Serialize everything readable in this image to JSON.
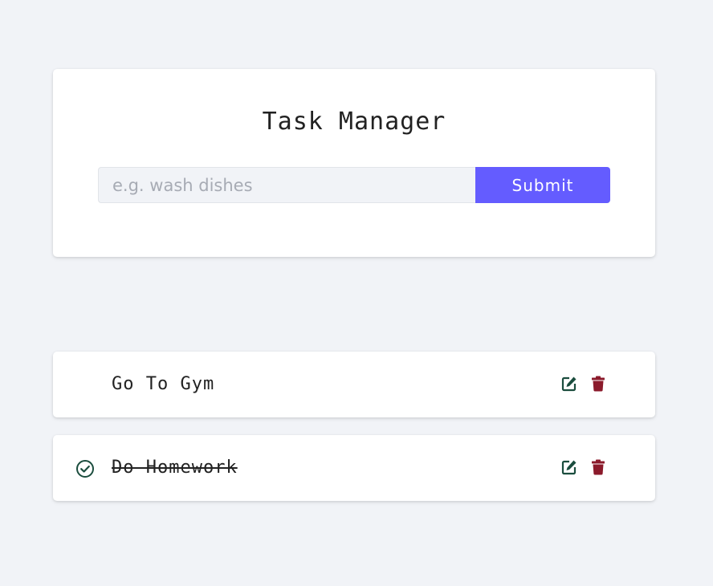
{
  "app": {
    "title": "Task Manager"
  },
  "form": {
    "input_placeholder": "e.g. wash dishes",
    "input_value": "",
    "submit_label": "Submit"
  },
  "tasks": [
    {
      "name": "Go To Gym",
      "completed": false,
      "edit_icon": "edit-icon",
      "delete_icon": "trash-icon"
    },
    {
      "name": "Do Homework",
      "completed": true,
      "status_icon": "check-circle-icon",
      "edit_icon": "edit-icon",
      "delete_icon": "trash-icon"
    }
  ],
  "colors": {
    "background": "#f1f3f7",
    "accent": "#645cff",
    "edit": "#1b4d3e",
    "delete": "#8b1a2b",
    "check": "#1b4d3e"
  }
}
